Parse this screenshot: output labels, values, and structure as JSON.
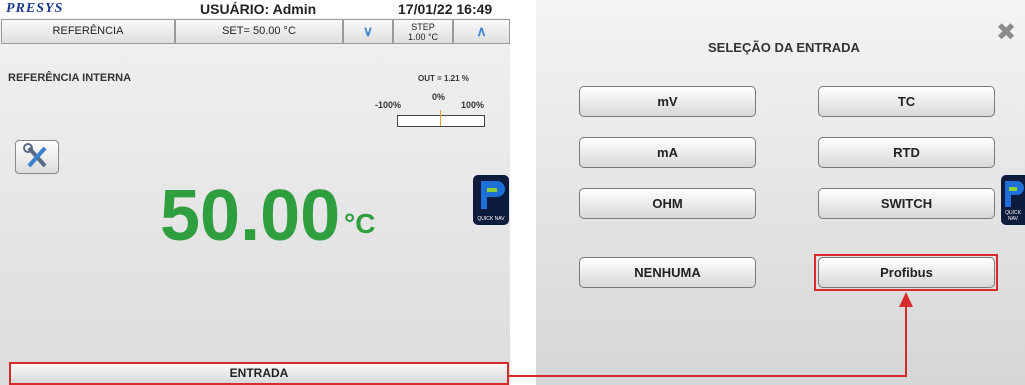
{
  "left_screen": {
    "header": {
      "logo": "PRESYS",
      "user": "USUÁRIO: Admin",
      "datetime": "17/01/22 16:49"
    },
    "toolbar": {
      "reference_tab": "REFERÊNCIA",
      "set_value": "SET= 50.00 °C",
      "step_label": "STEP",
      "step_value": "1.00 °C"
    },
    "reference_label": "REFERÊNCIA INTERNA",
    "output": {
      "label": "OUT = 1.21 %",
      "scale_min": "-100%",
      "scale_mid": "0%",
      "scale_max": "100%"
    },
    "reading": {
      "value": "50.00",
      "unit": "°C"
    },
    "quick_nav": "QUICK NAV",
    "bottom_button": "ENTRADA"
  },
  "right_screen": {
    "title": "SELEÇÃO DA ENTRADA",
    "close_icon": "close-icon",
    "options": [
      "mV",
      "TC",
      "mA",
      "RTD",
      "OHM",
      "SWITCH",
      "NENHUMA",
      "Profibus"
    ],
    "quick_nav": "QUICK NAV"
  },
  "colors": {
    "reading": "#2e9e3e",
    "highlight": "#d72b2b",
    "arrow_button": "#3f88d6"
  }
}
